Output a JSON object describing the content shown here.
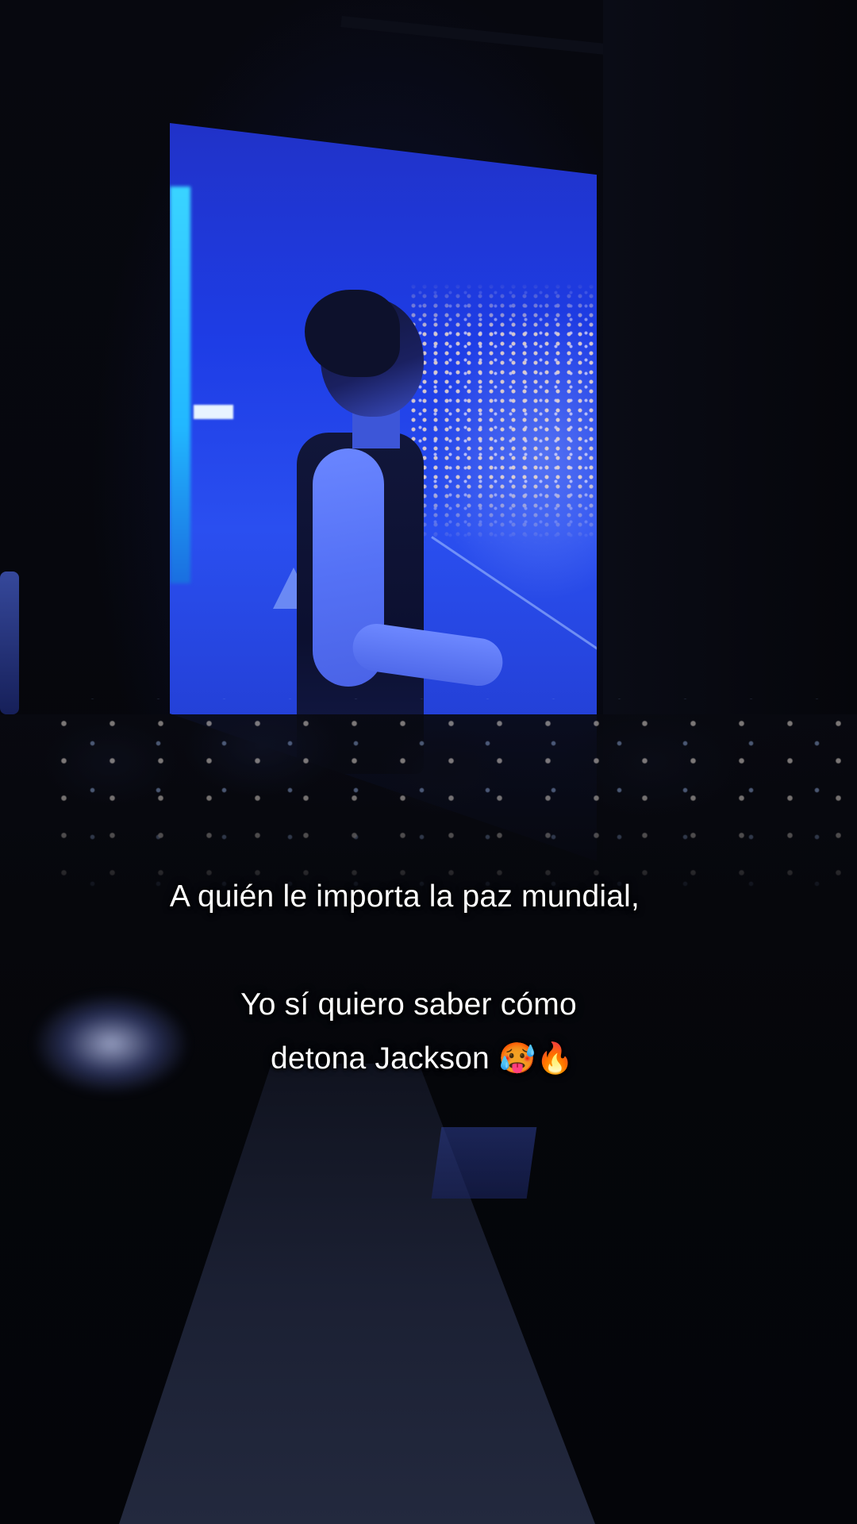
{
  "video": {
    "caption": {
      "line1": "A quién le importa la paz mundial,",
      "line2": "Yo sí quiero saber cómo",
      "line3_text": "detona Jackson",
      "line3_emoji_1": "🥵",
      "line3_emoji_2": "🔥"
    },
    "emoji_icons": [
      "hot-face-icon",
      "fire-icon"
    ],
    "colors": {
      "screen_blue": "#2a4ff0",
      "background": "#05060c",
      "caption_text": "#ffffff"
    }
  }
}
